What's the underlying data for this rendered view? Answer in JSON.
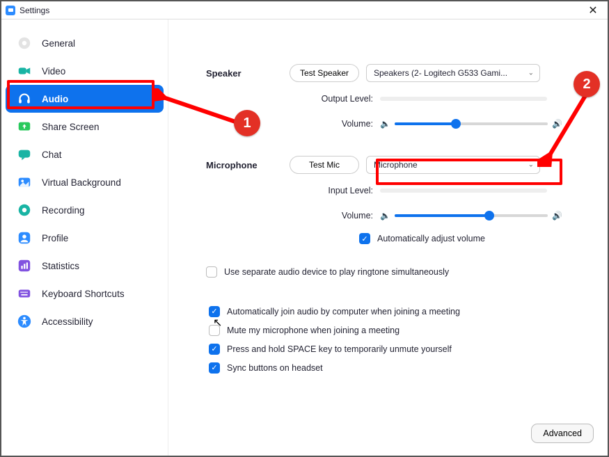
{
  "window": {
    "title": "Settings"
  },
  "sidebar": {
    "items": [
      {
        "label": "General",
        "icon": "gear-icon",
        "active": false
      },
      {
        "label": "Video",
        "icon": "video-icon",
        "active": false
      },
      {
        "label": "Audio",
        "icon": "headphones-icon",
        "active": true
      },
      {
        "label": "Share Screen",
        "icon": "share-icon",
        "active": false
      },
      {
        "label": "Chat",
        "icon": "chat-icon",
        "active": false
      },
      {
        "label": "Virtual Background",
        "icon": "virtualbg-icon",
        "active": false
      },
      {
        "label": "Recording",
        "icon": "record-icon",
        "active": false
      },
      {
        "label": "Profile",
        "icon": "profile-icon",
        "active": false
      },
      {
        "label": "Statistics",
        "icon": "stats-icon",
        "active": false
      },
      {
        "label": "Keyboard Shortcuts",
        "icon": "keyboard-icon",
        "active": false
      },
      {
        "label": "Accessibility",
        "icon": "accessibility-icon",
        "active": false
      }
    ]
  },
  "speaker": {
    "heading": "Speaker",
    "test_btn": "Test Speaker",
    "device": "Speakers (2- Logitech G533 Gami...",
    "output_level_label": "Output Level:",
    "volume_label": "Volume:",
    "volume_pct": 40
  },
  "microphone": {
    "heading": "Microphone",
    "test_btn": "Test Mic",
    "device": "Microphone",
    "input_level_label": "Input Level:",
    "volume_label": "Volume:",
    "volume_pct": 62,
    "auto_adjust_label": "Automatically adjust volume",
    "auto_adjust_checked": true
  },
  "options": {
    "separate_device_label": "Use separate audio device to play ringtone simultaneously",
    "separate_device_checked": false,
    "checks": [
      {
        "label": "Automatically join audio by computer when joining a meeting",
        "checked": true
      },
      {
        "label": "Mute my microphone when joining a meeting",
        "checked": false
      },
      {
        "label": "Press and hold SPACE key to temporarily unmute yourself",
        "checked": true
      },
      {
        "label": "Sync buttons on headset",
        "checked": true
      }
    ]
  },
  "advanced_btn": "Advanced",
  "annotations": {
    "badge1": "1",
    "badge2": "2"
  },
  "icon_colors": {
    "general": "#c9c9c9",
    "video": "#19b4a4",
    "audio_active": "#ffffff",
    "share": "#28c95c",
    "chat": "#19b4a4",
    "virtualbg": "#2d8cff",
    "recording": "#19b4a4",
    "profile": "#2d8cff",
    "statistics": "#8152e0",
    "keyboard": "#8152e0",
    "accessibility": "#2d8cff"
  }
}
